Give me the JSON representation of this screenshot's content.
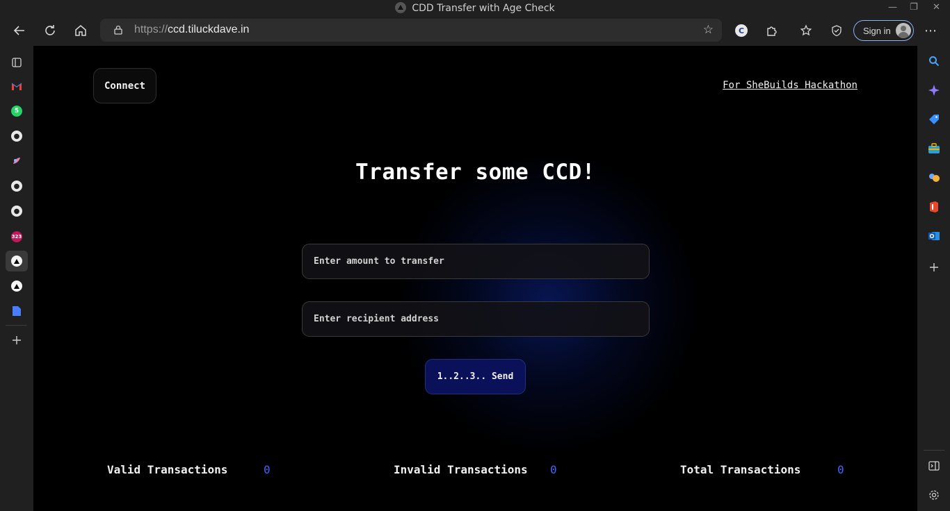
{
  "window": {
    "title": "CDD Transfer with Age Check"
  },
  "browser": {
    "url_protocol": "https://",
    "url_host": "ccd.tiluckdave.in",
    "signin_label": "Sign in"
  },
  "left_sidebar": {
    "items": [
      {
        "name": "tab-actions-icon"
      },
      {
        "name": "gmail-icon"
      },
      {
        "name": "whatsapp-icon",
        "badge": "5"
      },
      {
        "name": "github-icon"
      },
      {
        "name": "app-icon"
      },
      {
        "name": "github-icon"
      },
      {
        "name": "github-icon"
      },
      {
        "name": "app-icon",
        "badge": "323"
      },
      {
        "name": "vercel-icon"
      },
      {
        "name": "vercel-icon"
      },
      {
        "name": "docs-icon"
      }
    ]
  },
  "page": {
    "connect_label": "Connect",
    "hackathon_link": "For SheBuilds Hackathon",
    "title": "Transfer some CCD!",
    "amount_placeholder": "Enter amount to transfer",
    "recipient_placeholder": "Enter recipient address",
    "send_label": "1..2..3.. Send",
    "stats": {
      "valid_label": "Valid Transactions",
      "valid_value": "0",
      "invalid_label": "Invalid Transactions",
      "invalid_value": "0",
      "total_label": "Total Transactions",
      "total_value": "0"
    }
  },
  "colors": {
    "accent_blue": "#3d66ff",
    "send_bg": "#0b1158",
    "page_bg": "#000000"
  }
}
